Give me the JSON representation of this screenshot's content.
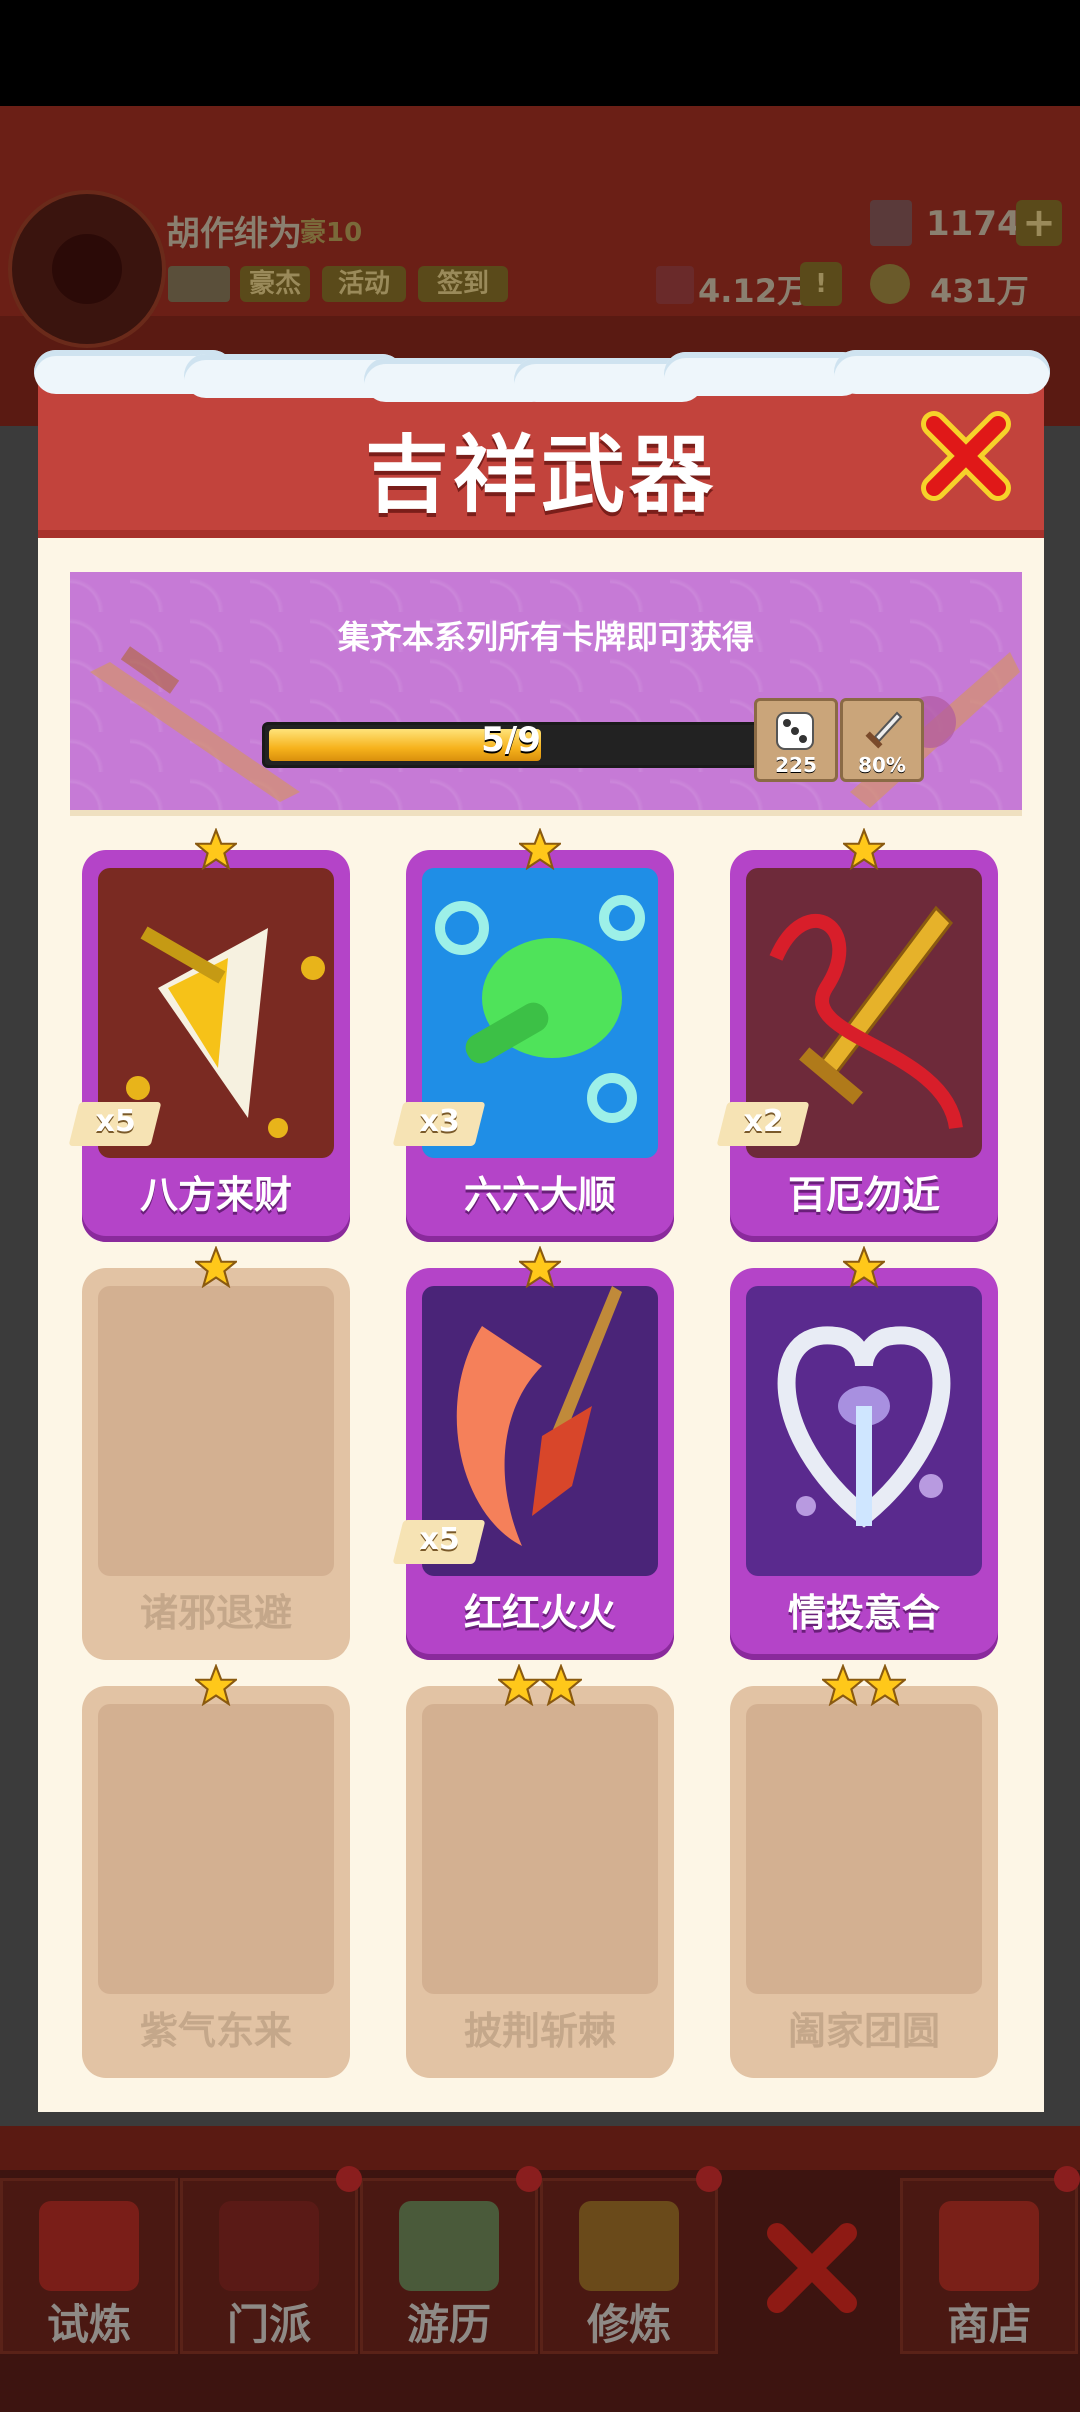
{
  "hud": {
    "player_name": "胡作绯为",
    "rank": "豪10",
    "gems": "1174",
    "add": "+",
    "buttons": [
      "豪杰",
      "活动",
      "签到"
    ],
    "power": "4.12万",
    "alert": "!",
    "coins": "431万"
  },
  "modal": {
    "title": "吉祥武器",
    "banner_text": "集齐本系列所有卡牌即可获得",
    "progress": {
      "current": 5,
      "total": 9,
      "label": "5/9"
    },
    "rewards": [
      {
        "icon": "dice-icon",
        "value": "225"
      },
      {
        "icon": "sword-icon",
        "value": "80%"
      }
    ]
  },
  "cards": [
    {
      "name": "八方来财",
      "count": "x5",
      "stars": 1,
      "unlocked": true,
      "art": "golden-axe-art",
      "bg": "#7a2a22"
    },
    {
      "name": "六六大顺",
      "count": "x3",
      "stars": 1,
      "unlocked": true,
      "art": "green-hand-art",
      "bg": "#1f8ee6"
    },
    {
      "name": "百厄勿近",
      "count": "x2",
      "stars": 1,
      "unlocked": true,
      "art": "golden-sword-art",
      "bg": "#6e2a3a"
    },
    {
      "name": "诸邪退避",
      "count": "",
      "stars": 1,
      "unlocked": false,
      "art": "",
      "bg": ""
    },
    {
      "name": "红红火火",
      "count": "x5",
      "stars": 1,
      "unlocked": true,
      "art": "fire-blade-art",
      "bg": "#4a2478"
    },
    {
      "name": "情投意合",
      "count": "",
      "stars": 1,
      "unlocked": true,
      "art": "heart-sword-art",
      "bg": "#5a2a8e"
    },
    {
      "name": "紫气东来",
      "count": "",
      "stars": 1,
      "unlocked": false,
      "art": "",
      "bg": ""
    },
    {
      "name": "披荆斩棘",
      "count": "",
      "stars": 2,
      "unlocked": false,
      "art": "",
      "bg": ""
    },
    {
      "name": "阖家团圆",
      "count": "",
      "stars": 2,
      "unlocked": false,
      "art": "",
      "bg": ""
    }
  ],
  "nav": [
    {
      "label": "试炼",
      "icon": "firecracker-icon"
    },
    {
      "label": "门派",
      "icon": "sect-gate-icon"
    },
    {
      "label": "游历",
      "icon": "mountain-icon"
    },
    {
      "label": "修炼",
      "icon": "book-icon"
    },
    {
      "label": "商店",
      "icon": "shop-icon"
    }
  ],
  "colors": {
    "header": "#c2433c",
    "card_unlocked": "#b444c8",
    "card_locked": "#e2c3a4",
    "banner": "#c67ad6",
    "progress": "#f6b21c"
  }
}
